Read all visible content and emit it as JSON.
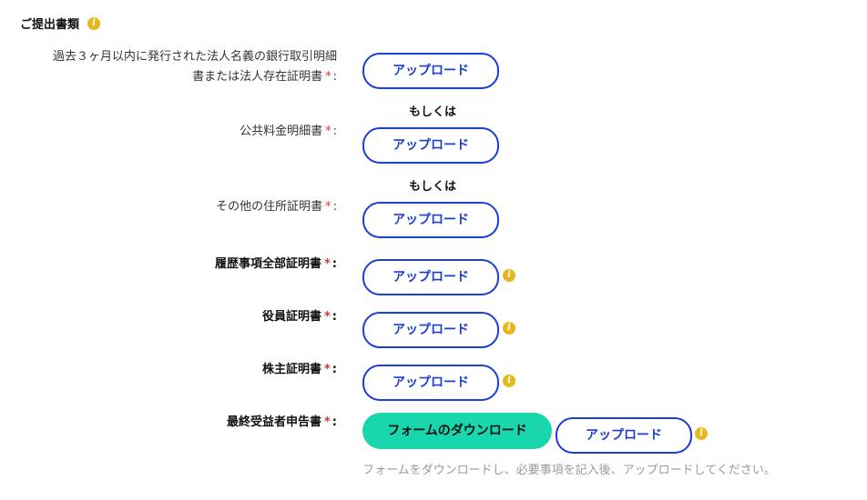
{
  "section": {
    "title": "ご提出書類"
  },
  "rows": [
    {
      "label_line1": "過去３ヶ月以内に発行された法人名義の銀行取引明細",
      "label_line2": "書または法人存在証明書",
      "required": "*",
      "colon": ":",
      "upload_label": "アップロード"
    },
    {
      "label": "公共料金明細書",
      "required": "*",
      "colon": ":",
      "upload_label": "アップロード"
    },
    {
      "label": "その他の住所証明書",
      "required": "*",
      "colon": ":",
      "upload_label": "アップロード"
    },
    {
      "label": "履歴事項全部証明書",
      "required": "*",
      "colon": ":",
      "upload_label": "アップロード"
    },
    {
      "label": "役員証明書",
      "required": "*",
      "colon": ":",
      "upload_label": "アップロード"
    },
    {
      "label": "株主証明書",
      "required": "*",
      "colon": ":",
      "upload_label": "アップロード"
    },
    {
      "label": "最終受益者申告書",
      "required": "*",
      "colon": ":",
      "download_label": "フォームのダウンロード",
      "upload_label": "アップロード"
    }
  ],
  "or_text": "もしくは",
  "info_glyph": "i",
  "note": "フォームをダウンロードし、必要事項を記入後、アップロードしてください。",
  "colors": {
    "accent": "#1a3fd4",
    "download": "#19d6ac",
    "required": "#e03131",
    "info": "#e6b820"
  }
}
